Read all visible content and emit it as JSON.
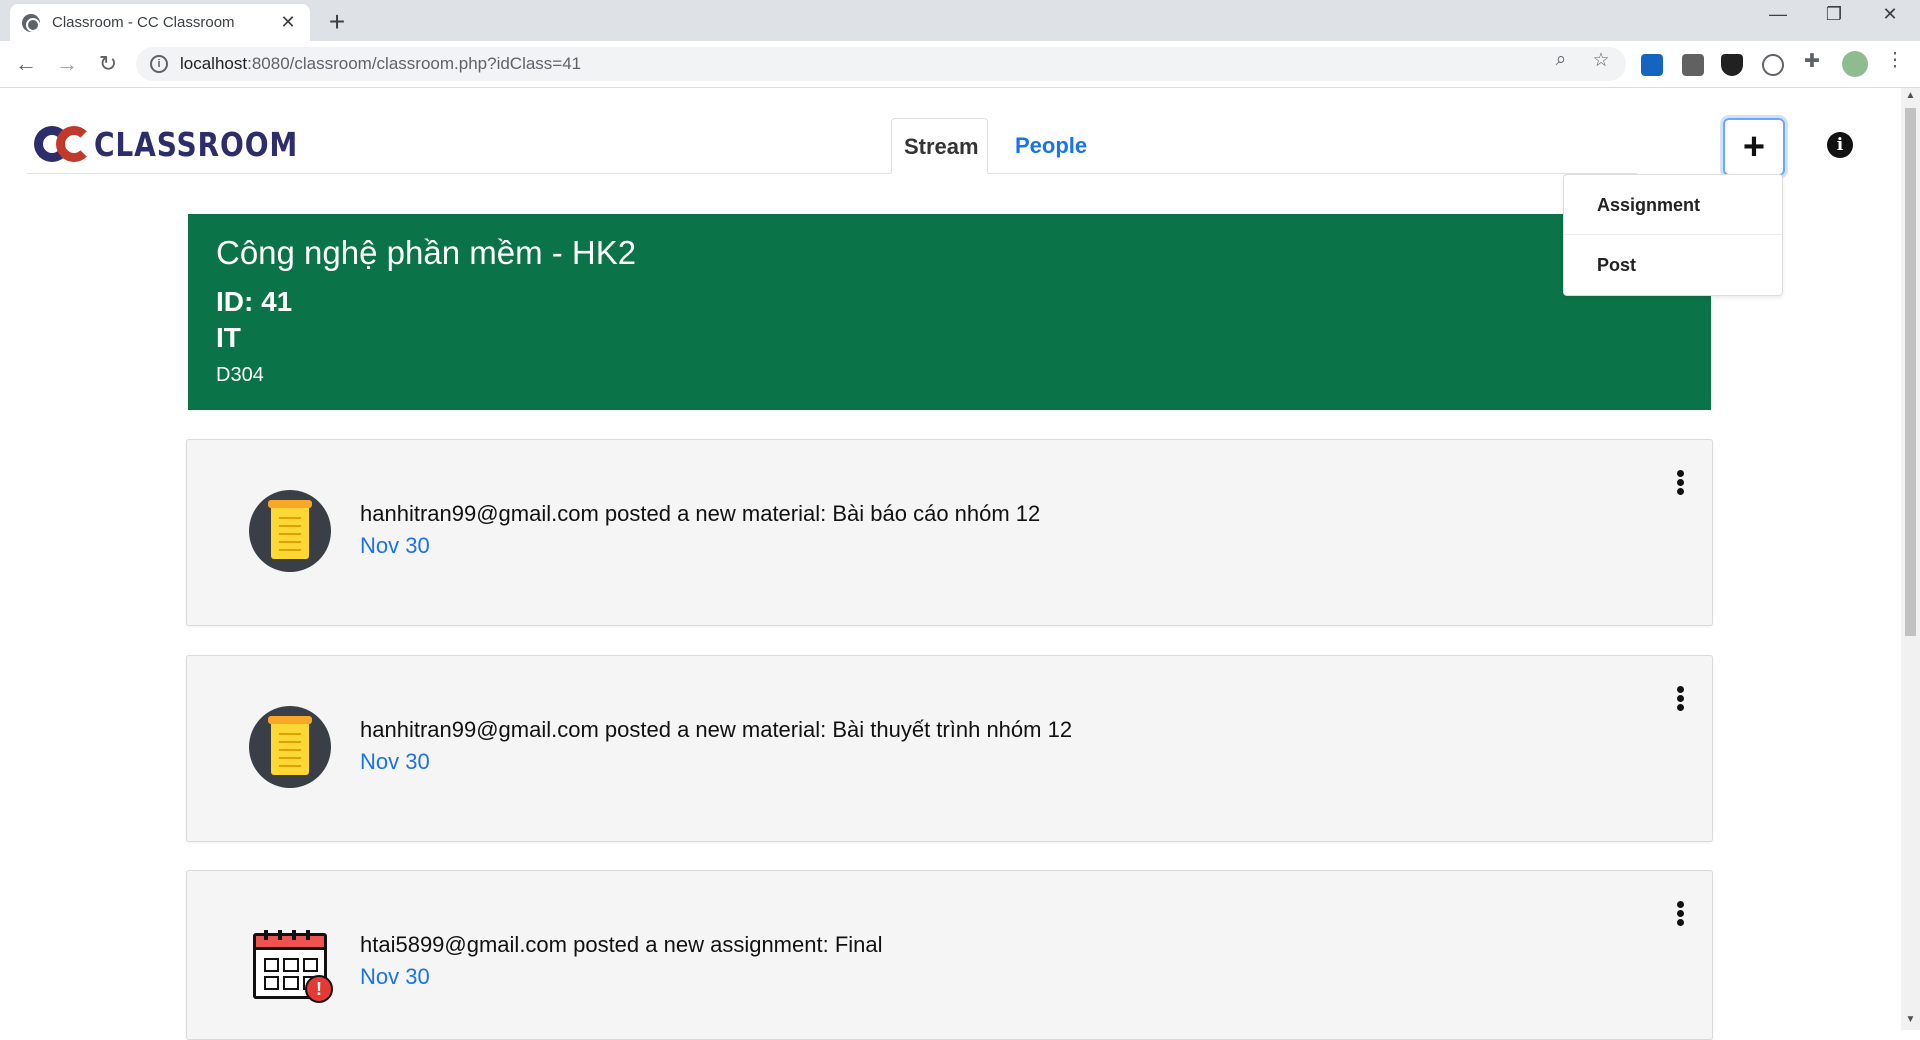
{
  "browser": {
    "tab_title": "Classroom - CC Classroom",
    "url_host": "localhost",
    "url_path": ":8080/classroom/classroom.php?idClass=41"
  },
  "app": {
    "logo_text": "CLASSROOM",
    "tabs": [
      {
        "label": "Stream",
        "active": true
      },
      {
        "label": "People",
        "active": false
      }
    ],
    "create_menu": [
      "Assignment",
      "Post"
    ],
    "accent_color": "#1a73e8",
    "banner_color": "#0a7347"
  },
  "classroom": {
    "title": "Công nghệ phần mềm - HK2",
    "id_line": "ID: 41",
    "subject": "IT",
    "room": "D304"
  },
  "stream": [
    {
      "icon": "material-note-icon",
      "message": "hanhitran99@gmail.com posted a new material: Bài báo cáo nhóm 12",
      "date": "Nov 30"
    },
    {
      "icon": "material-note-icon",
      "message": "hanhitran99@gmail.com posted a new material: Bài thuyết trình nhóm 12",
      "date": "Nov 30"
    },
    {
      "icon": "assignment-calendar-icon",
      "message": "htai5899@gmail.com posted a new assignment: Final",
      "date": "Nov 30"
    }
  ]
}
